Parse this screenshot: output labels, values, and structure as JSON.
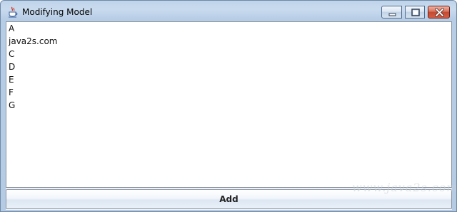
{
  "window": {
    "title": "Modifying Model",
    "icon": "java-cup-icon",
    "controls": [
      "minimize-icon",
      "maximize-icon",
      "close-icon"
    ]
  },
  "list": {
    "items": [
      "A",
      "java2s.com",
      "C",
      "D",
      "E",
      "F",
      "G"
    ]
  },
  "add_button": {
    "label": "Add"
  },
  "watermark": "www.java2s.com",
  "colors": {
    "titlebar": "#bfd3ea",
    "close_button": "#c44a32",
    "list_background": "#ffffff"
  }
}
